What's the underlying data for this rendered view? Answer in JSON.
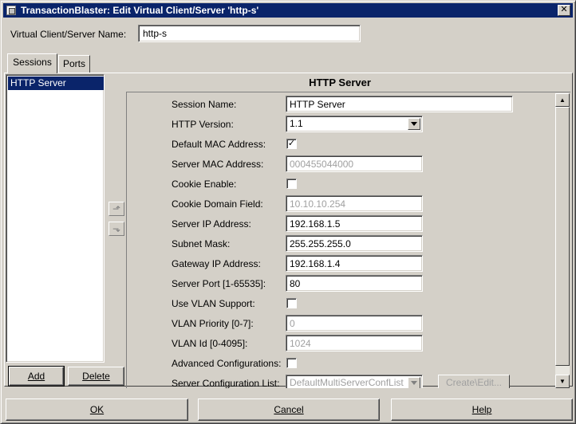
{
  "window": {
    "title": "TransactionBlaster: Edit Virtual Client/Server 'http-s'",
    "close_glyph": "✕"
  },
  "name_field": {
    "label": "Virtual Client/Server Name:",
    "value": "http-s"
  },
  "tabs": [
    {
      "label": "Sessions",
      "active": true
    },
    {
      "label": "Ports",
      "active": false
    }
  ],
  "sessions": {
    "items": [
      "HTTP Server"
    ],
    "selected": 0,
    "add_label": "Add",
    "delete_label": "Delete"
  },
  "panel": {
    "title": "HTTP Server",
    "fields": {
      "session_name": {
        "label": "Session Name:",
        "value": "HTTP Server"
      },
      "http_version": {
        "label": "HTTP Version:",
        "value": "1.1"
      },
      "default_mac": {
        "label": "Default MAC Address:",
        "checked": true
      },
      "server_mac": {
        "label": "Server MAC Address:",
        "value": "000455044000"
      },
      "cookie_enable": {
        "label": "Cookie Enable:",
        "checked": false
      },
      "cookie_domain": {
        "label": "Cookie Domain Field:",
        "value": "10.10.10.254"
      },
      "server_ip": {
        "label": "Server IP Address:",
        "value": "192.168.1.5"
      },
      "subnet_mask": {
        "label": "Subnet Mask:",
        "value": "255.255.255.0"
      },
      "gateway_ip": {
        "label": "Gateway IP Address:",
        "value": "192.168.1.4"
      },
      "server_port": {
        "label": "Server Port [1-65535]:",
        "value": "80"
      },
      "use_vlan": {
        "label": "Use VLAN Support:",
        "checked": false
      },
      "vlan_priority": {
        "label": "VLAN Priority [0-7]:",
        "value": "0"
      },
      "vlan_id": {
        "label": "VLAN Id [0-4095]:",
        "value": "1024"
      },
      "advanced": {
        "label": "Advanced Configurations:",
        "checked": false
      },
      "server_config_list": {
        "label": "Server Configuration List:",
        "value": "DefaultMultiServerConfList",
        "button": "Create\\Edit..."
      }
    }
  },
  "footer": {
    "ok_label": "OK",
    "cancel_label": "Cancel",
    "help_label": "Help"
  },
  "icons": {
    "check": "✓",
    "move_up": "⬏",
    "move_down": "⬎",
    "scroll_up": "▲",
    "scroll_down": "▼"
  },
  "colors": {
    "titlebar": "#0a246a",
    "selection": "#0a246a",
    "face": "#d4d0c8"
  }
}
